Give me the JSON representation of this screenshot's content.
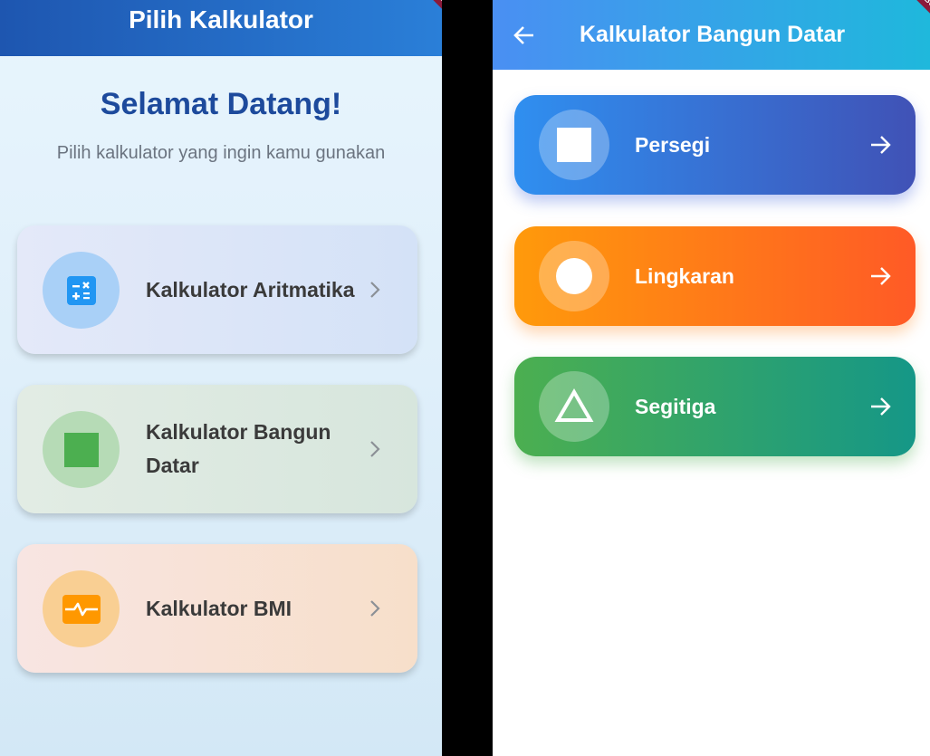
{
  "left": {
    "appbar_title": "Pilih Kalkulator",
    "welcome": "Selamat Datang!",
    "subtitle": "Pilih kalkulator yang ingin kamu gunakan",
    "cards": [
      {
        "label": "Kalkulator Aritmatika",
        "icon": "calculator-icon",
        "color": "#2196f3"
      },
      {
        "label": "Kalkulator Bangun Datar",
        "icon": "square-icon",
        "color": "#4caf50"
      },
      {
        "label": "Kalkulator BMI",
        "icon": "monitor-heart-icon",
        "color": "#ff9800"
      }
    ],
    "debug_badge": "DEBUG"
  },
  "right": {
    "appbar_title": "Kalkulator Bangun Datar",
    "shapes": [
      {
        "label": "Persegi",
        "icon": "square-icon"
      },
      {
        "label": "Lingkaran",
        "icon": "circle-icon"
      },
      {
        "label": "Segitiga",
        "icon": "triangle-icon"
      }
    ],
    "debug_badge": "DEBUG"
  }
}
